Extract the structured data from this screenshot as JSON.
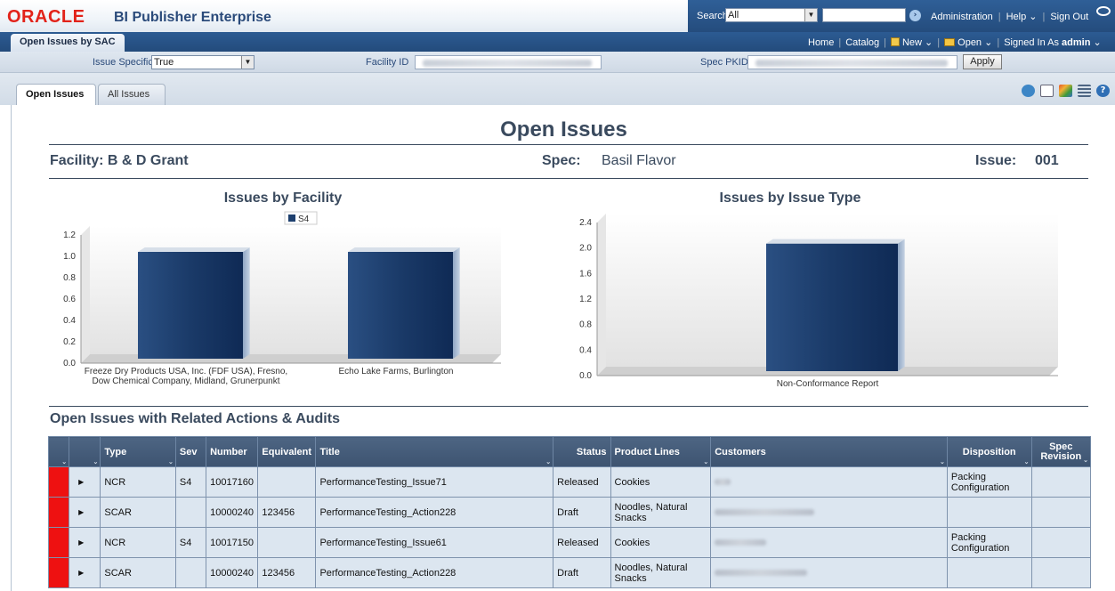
{
  "brand": {
    "logo": "ORACLE",
    "product": "BI Publisher Enterprise",
    "search_label": "Search",
    "search_scope": "All",
    "search_value": "",
    "links": [
      "Administration",
      "Help",
      "Sign Out"
    ]
  },
  "navbar": {
    "doc_tab": "Open Issues by SAC",
    "home": "Home",
    "catalog": "Catalog",
    "new": "New",
    "open": "Open",
    "signed_in_prefix": "Signed In As",
    "user": "admin"
  },
  "params": {
    "issue_specific_label": "Issue Specific",
    "issue_specific_value": "True",
    "facility_id_label": "Facility ID",
    "spec_pkid_label": "Spec PKID",
    "apply_label": "Apply"
  },
  "tabs": [
    {
      "label": "Open Issues",
      "active": true
    },
    {
      "label": "All Issues",
      "active": false
    }
  ],
  "report": {
    "title": "Open Issues",
    "facility_label": "Facility: B & D Grant",
    "spec_label": "Spec:",
    "spec_value": "Basil Flavor",
    "issue_label": "Issue:",
    "issue_value": "001",
    "section_title": "Open Issues with Related Actions & Audits"
  },
  "chart_data": [
    {
      "type": "bar",
      "title": "Issues by Facility",
      "legend": [
        "S4"
      ],
      "categories": [
        "Freeze Dry Products USA, Inc. (FDF USA), Fresno, Dow Chemical Company, Midland, Grunerpunkt",
        "Echo Lake Farms, Burlington"
      ],
      "category_lines": [
        [
          "Freeze Dry Products USA, Inc. (FDF USA), Fresno,",
          "Dow Chemical Company, Midland, Grunerpunkt"
        ],
        [
          "Echo Lake Farms, Burlington"
        ]
      ],
      "series": [
        {
          "name": "S4",
          "values": [
            1,
            1
          ]
        }
      ],
      "yticks": [
        "0.0",
        "0.2",
        "0.4",
        "0.6",
        "0.8",
        "1.0",
        "1.2"
      ],
      "ylim": [
        0,
        1.2
      ],
      "color": "#1d3f6e"
    },
    {
      "type": "bar",
      "title": "Issues by Issue Type",
      "categories": [
        "Non-Conformance Report"
      ],
      "category_lines": [
        [
          "Non-Conformance Report"
        ]
      ],
      "series": [
        {
          "values": [
            2
          ]
        }
      ],
      "yticks": [
        "0.0",
        "0.4",
        "0.8",
        "1.2",
        "1.6",
        "2.0",
        "2.4"
      ],
      "ylim": [
        0,
        2.4
      ],
      "color": "#1d3f6e"
    }
  ],
  "table": {
    "columns": [
      "",
      "",
      "Type",
      "Sev",
      "Number",
      "Equivalent",
      "Title",
      "Status",
      "Product Lines",
      "Customers",
      "Disposition",
      "Spec Revision"
    ],
    "rows": [
      {
        "type": "NCR",
        "sev": "S4",
        "number": "10017160",
        "equivalent": "",
        "title": "PerformanceTesting_Issue71",
        "status": "Released",
        "product_lines": "Cookies",
        "disposition": "Packing Configuration",
        "spec_revision": ""
      },
      {
        "type": "SCAR",
        "sev": "",
        "number": "10000240",
        "equivalent": "123456",
        "title": "PerformanceTesting_Action228",
        "status": "Draft",
        "product_lines": "Noodles, Natural Snacks",
        "disposition": "",
        "spec_revision": ""
      },
      {
        "type": "NCR",
        "sev": "S4",
        "number": "10017150",
        "equivalent": "",
        "title": "PerformanceTesting_Issue61",
        "status": "Released",
        "product_lines": "Cookies",
        "disposition": "Packing Configuration",
        "spec_revision": ""
      },
      {
        "type": "SCAR",
        "sev": "",
        "number": "10000240",
        "equivalent": "123456",
        "title": "PerformanceTesting_Action228",
        "status": "Draft",
        "product_lines": "Noodles, Natural Snacks",
        "disposition": "",
        "spec_revision": ""
      }
    ]
  },
  "colors": {
    "flag": "#ee1111",
    "header": "#3d5370",
    "accent": "#2a5485"
  }
}
